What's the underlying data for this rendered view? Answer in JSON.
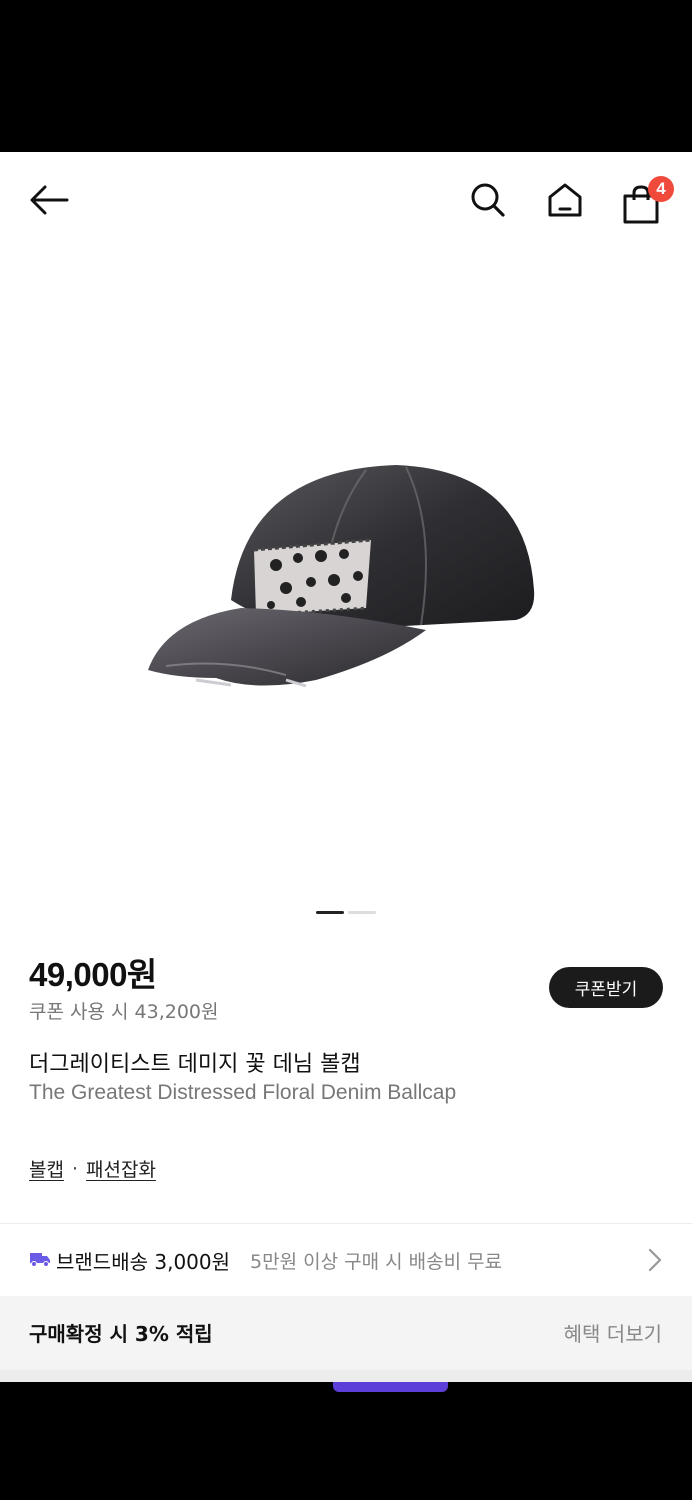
{
  "nav": {
    "back_icon": "arrow-left-icon",
    "search_icon": "search-icon",
    "home_icon": "home-icon",
    "cart_icon": "shopping-bag-icon",
    "cart_count": "4",
    "badge_color": "#ef4a3c"
  },
  "product": {
    "image_alt": "distressed floral denim ballcap",
    "pager": {
      "count": 2,
      "active": 0
    },
    "price": "49,000원",
    "coupon_price": "쿠폰 사용 시 43,200원",
    "coupon_button": "쿠폰받기",
    "title_ko": "더그레이티스트 데미지 꽃 데님 볼캡",
    "title_en": "The Greatest Distressed Floral Denim Ballcap",
    "categories": [
      "볼캡",
      "패션잡화"
    ],
    "category_separator": "·"
  },
  "shipping": {
    "icon": "truck-icon",
    "icon_color": "#6b5ce7",
    "label": "브랜드배송 3,000원",
    "note": "5만원 이상 구매 시 배송비 무료",
    "chevron_icon": "chevron-right-icon"
  },
  "reward": {
    "label": "구매확정 시 3% 적립",
    "more": "혜택 더보기"
  }
}
